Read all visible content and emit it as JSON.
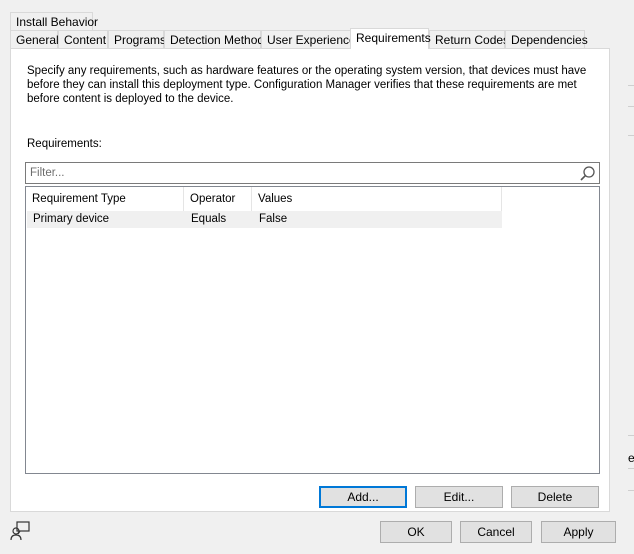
{
  "tabs_row1": [
    {
      "id": "install-behavior",
      "label": "Install Behavior"
    }
  ],
  "tabs_row2": [
    {
      "id": "general",
      "label": "General"
    },
    {
      "id": "content",
      "label": "Content"
    },
    {
      "id": "programs",
      "label": "Programs"
    },
    {
      "id": "detection-method",
      "label": "Detection Method"
    },
    {
      "id": "user-experience",
      "label": "User Experience"
    },
    {
      "id": "requirements",
      "label": "Requirements"
    },
    {
      "id": "return-codes",
      "label": "Return Codes"
    },
    {
      "id": "dependencies",
      "label": "Dependencies"
    }
  ],
  "selected_tab": "requirements",
  "description": "Specify any requirements, such as hardware features or the operating system version, that devices must have before they can install this deployment type. Configuration Manager verifies that these requirements are met before content is deployed to the device.",
  "requirements_label": "Requirements:",
  "filter": {
    "value": "",
    "placeholder": "Filter..."
  },
  "table": {
    "columns": [
      "Requirement Type",
      "Operator",
      "Values"
    ],
    "rows": [
      [
        "Primary device",
        "Equals",
        "False"
      ]
    ]
  },
  "panel_buttons": {
    "add": "Add...",
    "edit": "Edit...",
    "delete": "Delete"
  },
  "dialog_buttons": {
    "ok": "OK",
    "cancel": "Cancel",
    "apply": "Apply"
  },
  "right_edge_char": "e",
  "icons": {
    "search": "search-icon",
    "status": "user-feedback-icon"
  },
  "colors": {
    "accent": "#0078d7",
    "panel": "#ffffff",
    "background": "#f0f0f0"
  }
}
